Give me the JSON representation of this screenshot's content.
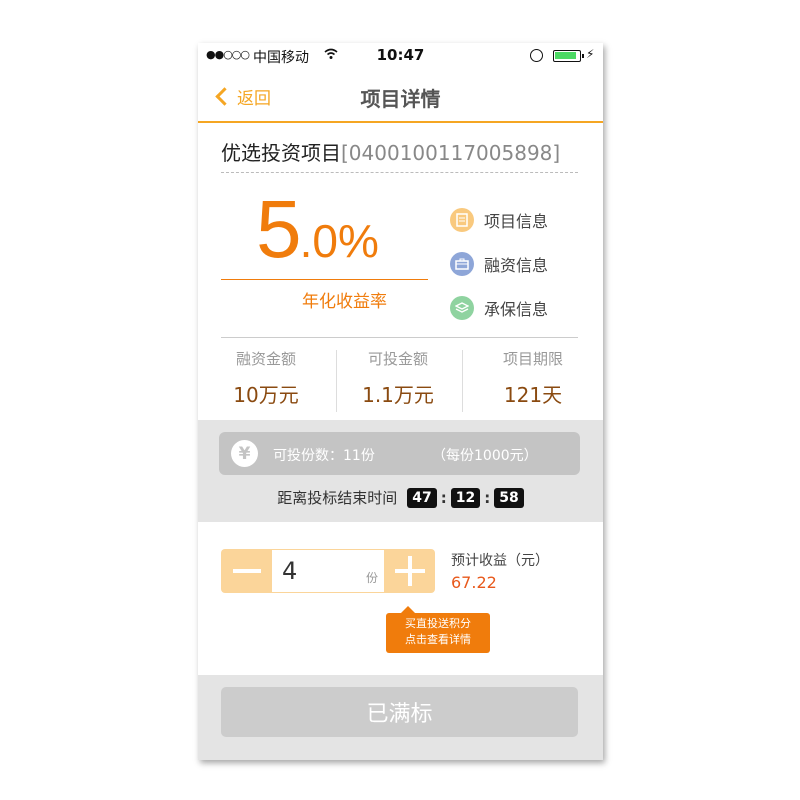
{
  "status_bar": {
    "signal": "●●○○○",
    "carrier": "中国移动",
    "time": "10:47"
  },
  "nav": {
    "back_label": "返回",
    "title": "项目详情"
  },
  "project": {
    "name": "优选投资项目",
    "code": "[0400100117005898]"
  },
  "rate": {
    "integer": "5",
    "decimal": ".0%",
    "label": "年化收益率",
    "color": "#f07c0c"
  },
  "info_links": [
    {
      "label": "项目信息",
      "icon": "document-icon",
      "color": "#f9c97e"
    },
    {
      "label": "融资信息",
      "icon": "briefcase-icon",
      "color": "#8ea6d8"
    },
    {
      "label": "承保信息",
      "icon": "layers-icon",
      "color": "#8fd3a0"
    }
  ],
  "stats": [
    {
      "label": "融资金额",
      "value": "10万元"
    },
    {
      "label": "可投金额",
      "value": "1.1万元"
    },
    {
      "label": "项目期限",
      "value": "121天"
    }
  ],
  "shares": {
    "yen_symbol": "¥",
    "available": "可投份数：11份",
    "per_share": "（每份1000元）"
  },
  "countdown": {
    "label": "距离投标结束时间",
    "hours": "47",
    "minutes": "12",
    "seconds": "58"
  },
  "purchase": {
    "quantity": "4",
    "unit": "份",
    "estimated_label": "预计收益（元）",
    "estimated_value": "67.22"
  },
  "tooltip": {
    "line1": "买直投送积分",
    "line2": "点击查看详情"
  },
  "submit": {
    "label": "已满标"
  }
}
